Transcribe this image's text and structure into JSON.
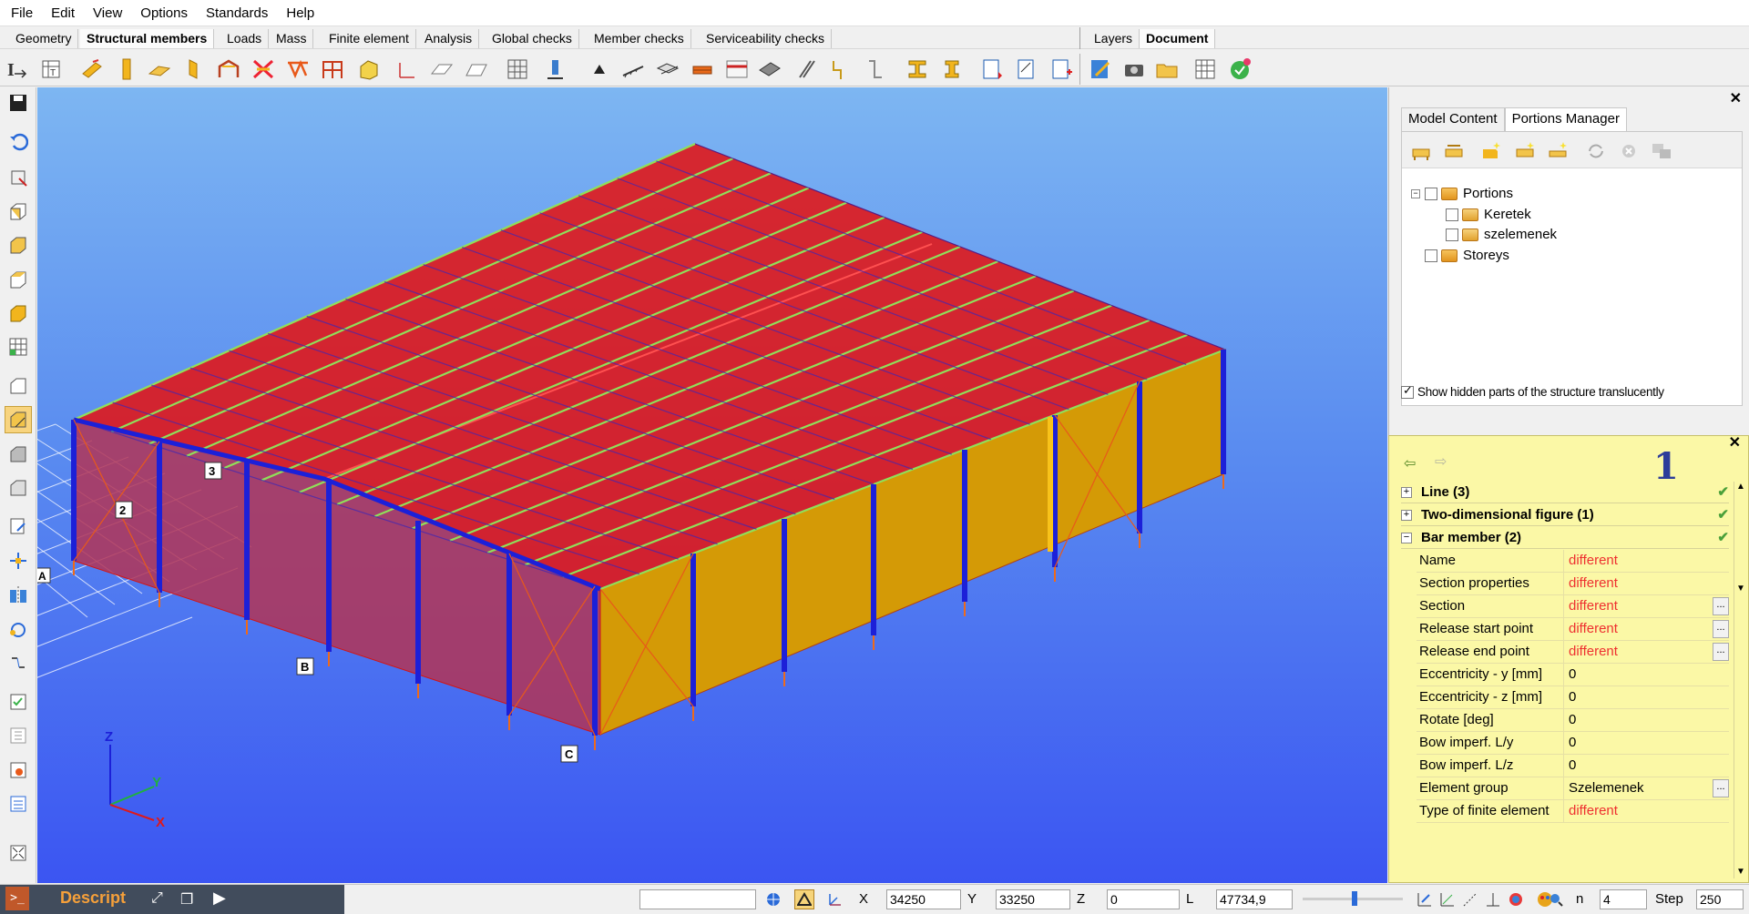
{
  "menubar": {
    "items": [
      "File",
      "Edit",
      "View",
      "Options",
      "Standards",
      "Help"
    ]
  },
  "tabs": {
    "left": [
      "Geometry",
      "Structural members",
      "Loads",
      "Mass",
      "Finite element",
      "Analysis",
      "Global checks",
      "Member checks",
      "Serviceability checks"
    ],
    "active": "Structural members",
    "right": [
      "Layers",
      "Document"
    ],
    "right_active": "Document"
  },
  "right_panel": {
    "tabs": [
      "Model Content",
      "Portions Manager"
    ],
    "active_tab": "Portions Manager",
    "tree": {
      "root": "Portions",
      "children": [
        "Keretek",
        "szelemenek"
      ],
      "second": "Storeys"
    },
    "show_hidden_label": "Show hidden parts of the structure translucently",
    "show_hidden_checked": true
  },
  "properties": {
    "page_number": "1",
    "groups": [
      {
        "label": "Line (3)",
        "expanded": false
      },
      {
        "label": "Two-dimensional figure (1)",
        "expanded": false
      },
      {
        "label": "Bar member (2)",
        "expanded": true
      }
    ],
    "rows": [
      {
        "key": "Name",
        "value": "different",
        "highlight": true,
        "button": false
      },
      {
        "key": "Section properties",
        "value": "different",
        "highlight": true,
        "button": false
      },
      {
        "key": "Section",
        "value": "different",
        "highlight": true,
        "button": true
      },
      {
        "key": "Release start point",
        "value": "different",
        "highlight": true,
        "button": true
      },
      {
        "key": "Release end point",
        "value": "different",
        "highlight": true,
        "button": true
      },
      {
        "key": "Eccentricity - y [mm]",
        "value": "0",
        "highlight": false,
        "button": false
      },
      {
        "key": "Eccentricity - z [mm]",
        "value": "0",
        "highlight": false,
        "button": false
      },
      {
        "key": "Rotate [deg]",
        "value": "0",
        "highlight": false,
        "button": false
      },
      {
        "key": "Bow imperf. L/y",
        "value": "0",
        "highlight": false,
        "button": false
      },
      {
        "key": "Bow imperf. L/z",
        "value": "0",
        "highlight": false,
        "button": false
      },
      {
        "key": "Element group",
        "value": "Szelemenek",
        "highlight": false,
        "button": true
      },
      {
        "key": "Type of finite element",
        "value": "different",
        "highlight": true,
        "button": false
      }
    ],
    "dots_label": "..."
  },
  "viewport": {
    "grid_labels": {
      "A": "A",
      "B": "B",
      "C": "C",
      "n2": "2",
      "n3": "3"
    },
    "axes": {
      "z": "Z",
      "y": "Y",
      "x": "X"
    }
  },
  "statusbar": {
    "script_prompt": ">_",
    "script_label": "Descript",
    "x_label": "X",
    "x_value": "34250",
    "y_label": "Y",
    "y_value": "33250",
    "z_label": "Z",
    "z_value": "0",
    "l_label": "L",
    "l_value": "47734,9",
    "n_label": "n",
    "n_value": "4",
    "step_label": "Step",
    "step_value": "250"
  },
  "colors": {
    "roof": "#e21414",
    "wall": "#d49a06",
    "column": "#1c20d8",
    "purlin": "#7ad24a",
    "sky_top": "#7db6f2",
    "sky_bottom": "#3b55f2",
    "props_bg": "#fbf8a6",
    "different": "#ee3030"
  }
}
